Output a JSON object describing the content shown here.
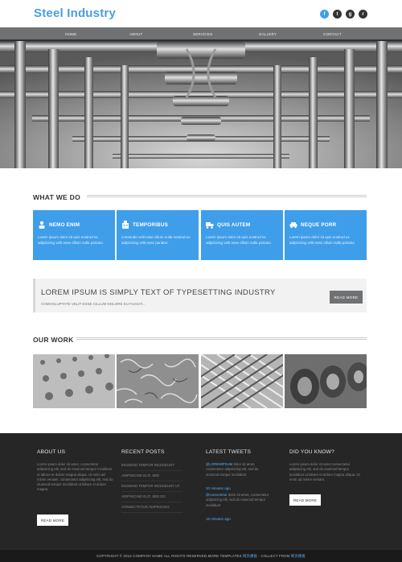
{
  "header": {
    "logo": "Steel Industry"
  },
  "social": [
    {
      "name": "facebook-icon",
      "glyph": "f",
      "color": "#3f9eea"
    },
    {
      "name": "twitter-icon",
      "glyph": "t",
      "color": "#333333"
    },
    {
      "name": "google-plus-icon",
      "glyph": "g",
      "color": "#333333"
    },
    {
      "name": "rss-icon",
      "glyph": "r",
      "color": "#333333"
    }
  ],
  "nav": [
    "HOME",
    "ABOUT",
    "SERVICES",
    "GALLERY",
    "CONTACT"
  ],
  "what_we_do": {
    "title": "WHAT WE DO",
    "boxes": [
      {
        "title": "NEMO ENIM",
        "icon": "user-icon",
        "text": "Lorem ipsum dolor sit quis nostrud ex adipisicing velit esse cillum nulla pariatur."
      },
      {
        "title": "TEMPORIBUS",
        "icon": "building-icon",
        "text": "commodo velit esse cillum nulla nostrud ex adipisicing velit esse pariatur."
      },
      {
        "title": "QUIS AUTEM",
        "icon": "truck-icon",
        "text": "Lorem ipsum dolor sit quis nostrud ex adipisicing velit esse cillum nulla pariatur."
      },
      {
        "title": "NEQUE PORR",
        "icon": "car-icon",
        "text": "Lorem ipsum dolor sit quis nostrud ex adipisicing velit esse cillum nulla pariatur."
      }
    ]
  },
  "banner": {
    "title": "LOREM IPSUM IS SIMPLY TEXT OF TYPESETTING INDUSTRY",
    "subtitle": "COMVOLUPTATE VELIT ESSE CILLUM DOLORE EU FUGIAT...",
    "button": "READ MORE"
  },
  "our_work": {
    "title": "OUR WORK"
  },
  "footer": {
    "about": {
      "title": "ABOUT US",
      "text": "Lorem ipsum dolor sit amet, consectetur adipisicing elit, sed do eiusmod tempor incididunt ut labore et dolore magna aliqua. Ut enim ad minim veniam, consectetur adipisicing elit, sed do eiusmod tempor incididunt ut labore et dolore magna.",
      "button": "READ MORE"
    },
    "recent": {
      "title": "RECENT POSTS",
      "items": [
        "EIUSMOD TEMPOR INCIDIDUNT",
        "ADIPISICING ELIT, SED",
        "EIUSMOD TEMPOR INCIDIDUNT UT",
        "ADIPISICING ELIT, SED DO",
        "CONSECTETUR ADIPISICING"
      ]
    },
    "tweets": {
      "title": "LATEST TWEETS",
      "items": [
        {
          "handle": "@LOREMIPSUM",
          "text": "dolor sit amet, consectetur adipisicing elit, sed do eiusmod tempor incididunt",
          "time": "10 minutes ago"
        },
        {
          "handle": "@consectetur",
          "text": "dolor sit amet, consectetur adipisicing elit, sed do eiusmod tempor incididunt",
          "time": "15 minutes ago"
        }
      ]
    },
    "know": {
      "title": "DID YOU KNOW?",
      "text": "Lorem ipsum dolor sit amet consectetur adipisicing elit, sed do eiusmod tempor incididunt ut labore et dolore magna aliqua. Ut enim ad minim veniam.",
      "button": "READ MORE"
    }
  },
  "copyright": {
    "prefix": "COPYRIGHT © 2014 COMPANY NAME ALL RIGHTS RESERVED.MORE TEMPLATES",
    "link1": "网页模板",
    "mid": " - COLLECT FROM ",
    "link2": "网页模板"
  }
}
